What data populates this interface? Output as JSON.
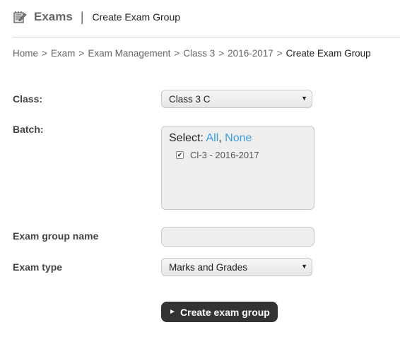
{
  "header": {
    "icon": "notepad-pencil-icon",
    "title": "Exams",
    "separator": "|",
    "subtitle": "Create Exam Group"
  },
  "breadcrumb": {
    "separator": ">",
    "items": [
      "Home",
      "Exam",
      "Exam Management",
      "Class 3",
      "2016-2017"
    ],
    "current": "Create Exam Group"
  },
  "form": {
    "class": {
      "label": "Class:",
      "value": "Class 3 C",
      "arrow": "▼"
    },
    "batch": {
      "label": "Batch:",
      "select_prefix": "Select:",
      "all_link": "All",
      "comma": ",",
      "none_link": "None",
      "items": [
        {
          "label": "Cl-3 - 2016-2017",
          "checked": true,
          "mark": "✔"
        }
      ]
    },
    "exam_group_name": {
      "label": "Exam group name",
      "value": "",
      "placeholder": ""
    },
    "exam_type": {
      "label": "Exam type",
      "value": "Marks and Grades",
      "arrow": "▼"
    },
    "submit": {
      "icon": "►",
      "label": "Create exam group"
    }
  },
  "colors": {
    "link": "#3a9ee0",
    "button_bg": "#333333",
    "field_bg": "#eeeeee"
  }
}
